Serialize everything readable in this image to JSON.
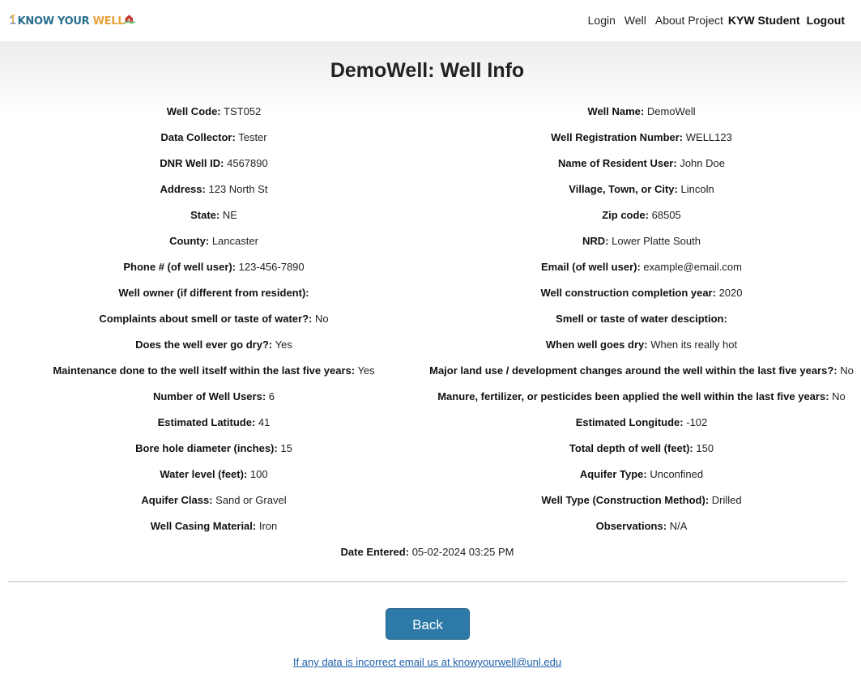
{
  "brand": {
    "logo_text_know": "KNOW YOUR ",
    "logo_text_well": "WELL"
  },
  "nav": {
    "login": "Login",
    "well": "Well",
    "about": "About Project",
    "user": "KYW Student",
    "logout": "Logout"
  },
  "page": {
    "title": "DemoWell: Well Info"
  },
  "rows": [
    {
      "left_label": "Well Code:",
      "left_value": "TST052",
      "right_label": "Well Name:",
      "right_value": "DemoWell"
    },
    {
      "left_label": "Data Collector:",
      "left_value": "Tester",
      "right_label": "Well Registration Number:",
      "right_value": "WELL123"
    },
    {
      "left_label": "DNR Well ID:",
      "left_value": "4567890",
      "right_label": "Name of Resident User:",
      "right_value": "John Doe"
    },
    {
      "left_label": "Address:",
      "left_value": "123 North St",
      "right_label": "Village, Town, or City:",
      "right_value": "Lincoln"
    },
    {
      "left_label": "State:",
      "left_value": "NE",
      "right_label": "Zip code:",
      "right_value": "68505"
    },
    {
      "left_label": "County:",
      "left_value": "Lancaster",
      "right_label": "NRD:",
      "right_value": "Lower Platte South"
    },
    {
      "left_label": "Phone # (of well user):",
      "left_value": "123-456-7890",
      "right_label": "Email (of well user):",
      "right_value": "example@email.com"
    },
    {
      "left_label": "Well owner (if different from resident):",
      "left_value": "",
      "right_label": "Well construction completion year:",
      "right_value": "2020"
    },
    {
      "left_label": "Complaints about smell or taste of water?:",
      "left_value": "No",
      "right_label": "Smell or taste of water desciption:",
      "right_value": ""
    },
    {
      "left_label": "Does the well ever go dry?:",
      "left_value": "Yes",
      "right_label": "When well goes dry:",
      "right_value": "When its really hot"
    },
    {
      "left_label": "Maintenance done to the well itself within the last five years:",
      "left_value": "Yes",
      "right_label": "Major land use / development changes around the well within the last five years?:",
      "right_value": "No"
    },
    {
      "left_label": "Number of Well Users:",
      "left_value": "6",
      "right_label": "Manure, fertilizer, or pesticides been applied the well within the last five years:",
      "right_value": "No"
    },
    {
      "left_label": "Estimated Latitude:",
      "left_value": "41",
      "right_label": "Estimated Longitude:",
      "right_value": "-102"
    },
    {
      "left_label": "Bore hole diameter (inches):",
      "left_value": "15",
      "right_label": "Total depth of well (feet):",
      "right_value": "150"
    },
    {
      "left_label": "Water level (feet):",
      "left_value": "100",
      "right_label": "Aquifer Type:",
      "right_value": "Unconfined"
    },
    {
      "left_label": "Aquifer Class:",
      "left_value": "Sand or Gravel",
      "right_label": "Well Type (Construction Method):",
      "right_value": "Drilled"
    },
    {
      "left_label": "Well Casing Material:",
      "left_value": "Iron",
      "right_label": "Observations:",
      "right_value": "N/A"
    }
  ],
  "date_entered": {
    "label": "Date Entered:",
    "value": "05-02-2024 03:25 PM"
  },
  "actions": {
    "back_label": "Back",
    "email_link": "If any data is incorrect email us at knowyourwell@unl.edu"
  },
  "colors": {
    "button": "#2d7aa8",
    "link": "#1f5fa8",
    "brand_blue": "#2a6f8f",
    "brand_orange": "#e9a23b"
  }
}
